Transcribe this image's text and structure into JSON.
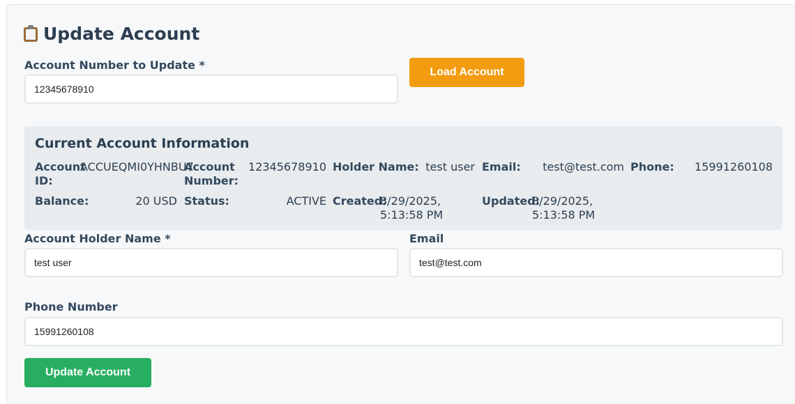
{
  "page": {
    "title": "Update Account",
    "title_icon": "clipboard-icon"
  },
  "load_form": {
    "account_number_label": "Account Number to Update *",
    "account_number_value": "12345678910",
    "load_button_label": "Load Account"
  },
  "current_info": {
    "heading": "Current Account Information",
    "account_id_label": "Account ID:",
    "account_id_value": "ACCUEQMI0YHNBU7",
    "account_number_label": "Account Number:",
    "account_number_value": "12345678910",
    "holder_name_label": "Holder Name:",
    "holder_name_value": "test user",
    "email_label": "Email:",
    "email_value": "test@test.com",
    "phone_label": "Phone:",
    "phone_value": "15991260108",
    "balance_label": "Balance:",
    "balance_value": "20 USD",
    "status_label": "Status:",
    "status_value": "ACTIVE",
    "created_label": "Created:",
    "created_value": "8/29/2025, 5:13:58 PM",
    "updated_label": "Updated:",
    "updated_value": "8/29/2025, 5:13:58 PM"
  },
  "update_form": {
    "holder_name_label": "Account Holder Name *",
    "holder_name_value": "test user",
    "email_label": "Email",
    "email_value": "test@test.com",
    "phone_label": "Phone Number",
    "phone_value": "15991260108",
    "update_button_label": "Update Account"
  },
  "colors": {
    "load_button": "#f39c12",
    "update_button": "#27ae60",
    "heading_text": "#2c3e50"
  }
}
